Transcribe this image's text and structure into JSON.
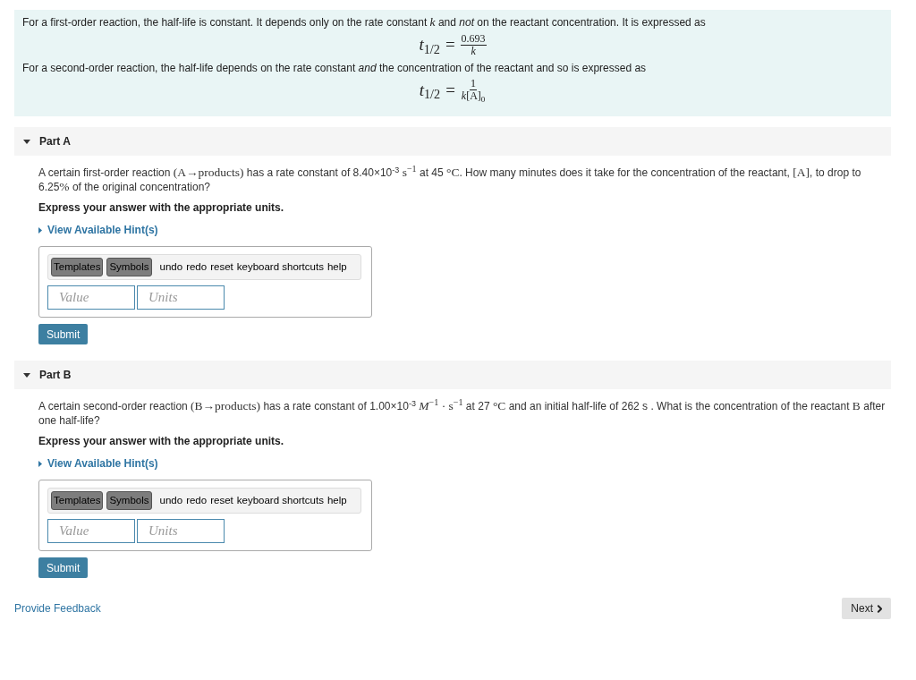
{
  "intro": {
    "blocks": [
      {
        "kind": "text",
        "segments": [
          {
            "kind": "text",
            "text": "For a first-order reaction, the half-life is constant. It depends only on the rate constant "
          },
          {
            "kind": "math",
            "text": "*k*"
          },
          {
            "kind": "text",
            "text": " and *not* on the reactant concentration. It is expressed as"
          }
        ]
      },
      {
        "kind": "formula",
        "lhs": "*t*$_{1/2}$",
        "operator": "=",
        "numerator": "0.693",
        "denominator": "*k*"
      },
      {
        "kind": "text",
        "segments": [
          {
            "kind": "text",
            "text": "For a second-order reaction, the half-life depends on the rate constant *and* the concentration of the reactant and so is expressed as"
          }
        ]
      },
      {
        "kind": "formula",
        "lhs": "*t*$_{1/2}$",
        "operator": "=",
        "numerator": "1",
        "denominator": "*k*[A]$_{0}$"
      }
    ]
  },
  "parts": [
    {
      "title": "Part A",
      "expanded": true,
      "question": [
        {
          "kind": "text",
          "text": "A certain first-order reaction "
        },
        {
          "kind": "math",
          "text": "(A→products)"
        },
        {
          "kind": "text",
          "text": " has a rate constant of 8.40×10$^{-3}$ "
        },
        {
          "kind": "math",
          "text": "s$^{−1}$"
        },
        {
          "kind": "text",
          "text": " at 45 "
        },
        {
          "kind": "math",
          "text": "°C"
        },
        {
          "kind": "text",
          "text": ". How many minutes does it take for the concentration of the reactant, "
        },
        {
          "kind": "math",
          "text": "[A]"
        },
        {
          "kind": "text",
          "text": ", to drop to 6.25"
        },
        {
          "kind": "math",
          "text": "%"
        },
        {
          "kind": "text",
          "text": " of the original concentration?"
        }
      ],
      "instruction": "Express your answer with the appropriate units.",
      "hint_link": "View Available Hint(s)",
      "toolbar": [
        {
          "kind": "button",
          "label": "Templates"
        },
        {
          "kind": "button",
          "label": "Symbols"
        },
        {
          "kind": "link",
          "label": "undo"
        },
        {
          "kind": "link",
          "label": "redo"
        },
        {
          "kind": "link",
          "label": "reset"
        },
        {
          "kind": "link",
          "label": "keyboard shortcuts"
        },
        {
          "kind": "link",
          "label": "help"
        }
      ],
      "inputs": [
        {
          "placeholder": "Value"
        },
        {
          "placeholder": "Units"
        }
      ],
      "submit": "Submit"
    },
    {
      "title": "Part B",
      "expanded": true,
      "question": [
        {
          "kind": "text",
          "text": "A certain second-order reaction "
        },
        {
          "kind": "math",
          "text": "(B→products)"
        },
        {
          "kind": "text",
          "text": " has a rate constant of 1.00×10$^{-3}$ "
        },
        {
          "kind": "math",
          "text": "*M*$^{−1}$ · s$^{−1}$"
        },
        {
          "kind": "text",
          "text": " at 27 "
        },
        {
          "kind": "math",
          "text": "°C"
        },
        {
          "kind": "text",
          "text": " and an initial half-life of 262 s . What is the concentration of the reactant "
        },
        {
          "kind": "math",
          "text": "B"
        },
        {
          "kind": "text",
          "text": " after one half-life?"
        }
      ],
      "instruction": "Express your answer with the appropriate units.",
      "hint_link": "View Available Hint(s)",
      "toolbar": [
        {
          "kind": "button",
          "label": "Templates"
        },
        {
          "kind": "button",
          "label": "Symbols"
        },
        {
          "kind": "link",
          "label": "undo"
        },
        {
          "kind": "link",
          "label": "redo"
        },
        {
          "kind": "link",
          "label": "reset"
        },
        {
          "kind": "link",
          "label": "keyboard shortcuts"
        },
        {
          "kind": "link",
          "label": "help"
        }
      ],
      "inputs": [
        {
          "placeholder": "Value"
        },
        {
          "placeholder": "Units"
        }
      ],
      "submit": "Submit"
    }
  ],
  "footer": {
    "feedback_link": "Provide Feedback",
    "next_button": "Next"
  }
}
